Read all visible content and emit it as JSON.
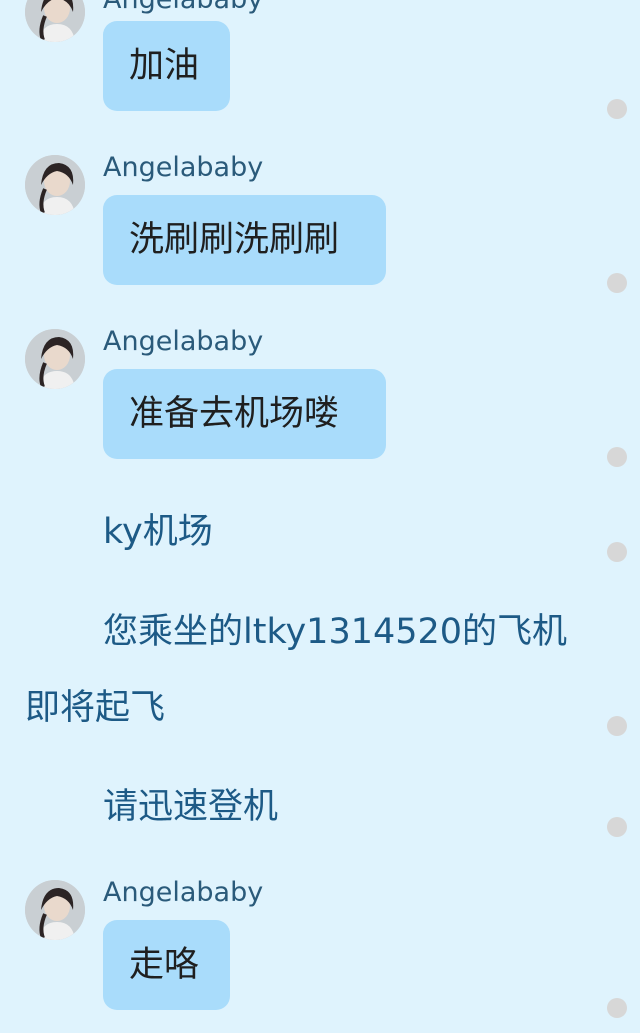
{
  "messages": [
    {
      "type": "bubble",
      "sender": "Angelababy",
      "text": "加油"
    },
    {
      "type": "bubble",
      "sender": "Angelababy",
      "text": "洗刷刷洗刷刷"
    },
    {
      "type": "bubble",
      "sender": "Angelababy",
      "text": "准备去机场喽"
    },
    {
      "type": "plain",
      "text": "ky机场"
    },
    {
      "type": "plain",
      "line1": "您乘坐的ltky1314520的飞机",
      "line2": "即将起飞"
    },
    {
      "type": "plain",
      "text": "请迅速登机"
    },
    {
      "type": "bubble",
      "sender": "Angelababy",
      "text": "走咯"
    }
  ],
  "colors": {
    "background": "#dff3fd",
    "bubble": "#a9dcfb",
    "sender": "#2a5a7a",
    "plain_text": "#1d5a86",
    "select_circle": "#d7d7d7"
  },
  "icons": {
    "avatar": "user-avatar-photo",
    "select": "select-circle-icon"
  }
}
